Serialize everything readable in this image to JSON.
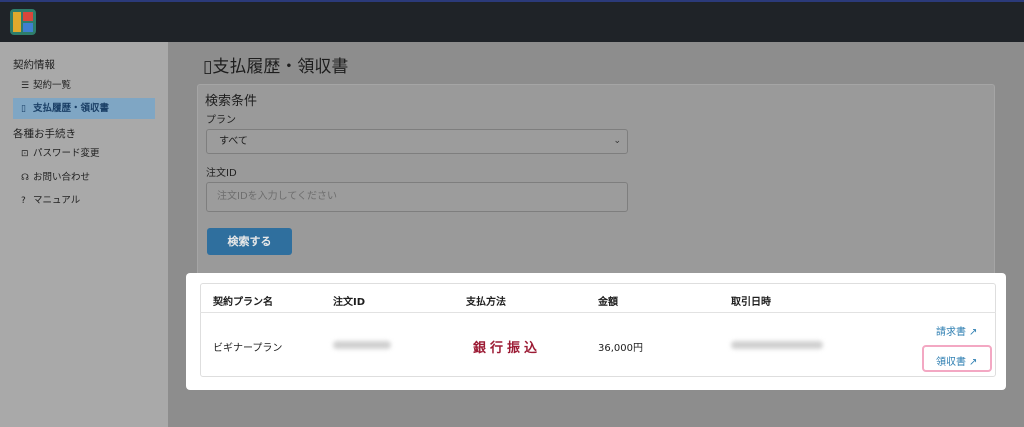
{
  "header": {
    "logo": "logo-icon"
  },
  "sidebar": {
    "section1": "契約情報",
    "item_contracts": "契約一覧",
    "item_payments": "支払履歴・領収書",
    "section2": "各種お手続き",
    "item_password": "パスワード変更",
    "item_contact": "お問い合わせ",
    "item_manual": "マニュアル"
  },
  "main": {
    "title": "支払履歴・領収書",
    "search": {
      "title": "検索条件",
      "plan_label": "プラン",
      "plan_value": "すべて",
      "order_label": "注文ID",
      "order_placeholder": "注文IDを入力してください",
      "button": "検索する"
    },
    "table": {
      "headers": [
        "契約プラン名",
        "注文ID",
        "支払方法",
        "金額",
        "取引日時"
      ],
      "row": {
        "plan": "ビギナープラン",
        "method": "銀行振込",
        "amount": "36,000円",
        "invoice": "請求書",
        "receipt": "領収書"
      }
    }
  },
  "colors": {
    "accent": "#2f6f9e",
    "bank": "#9c1b34",
    "highlight": "#f3a8c3"
  }
}
